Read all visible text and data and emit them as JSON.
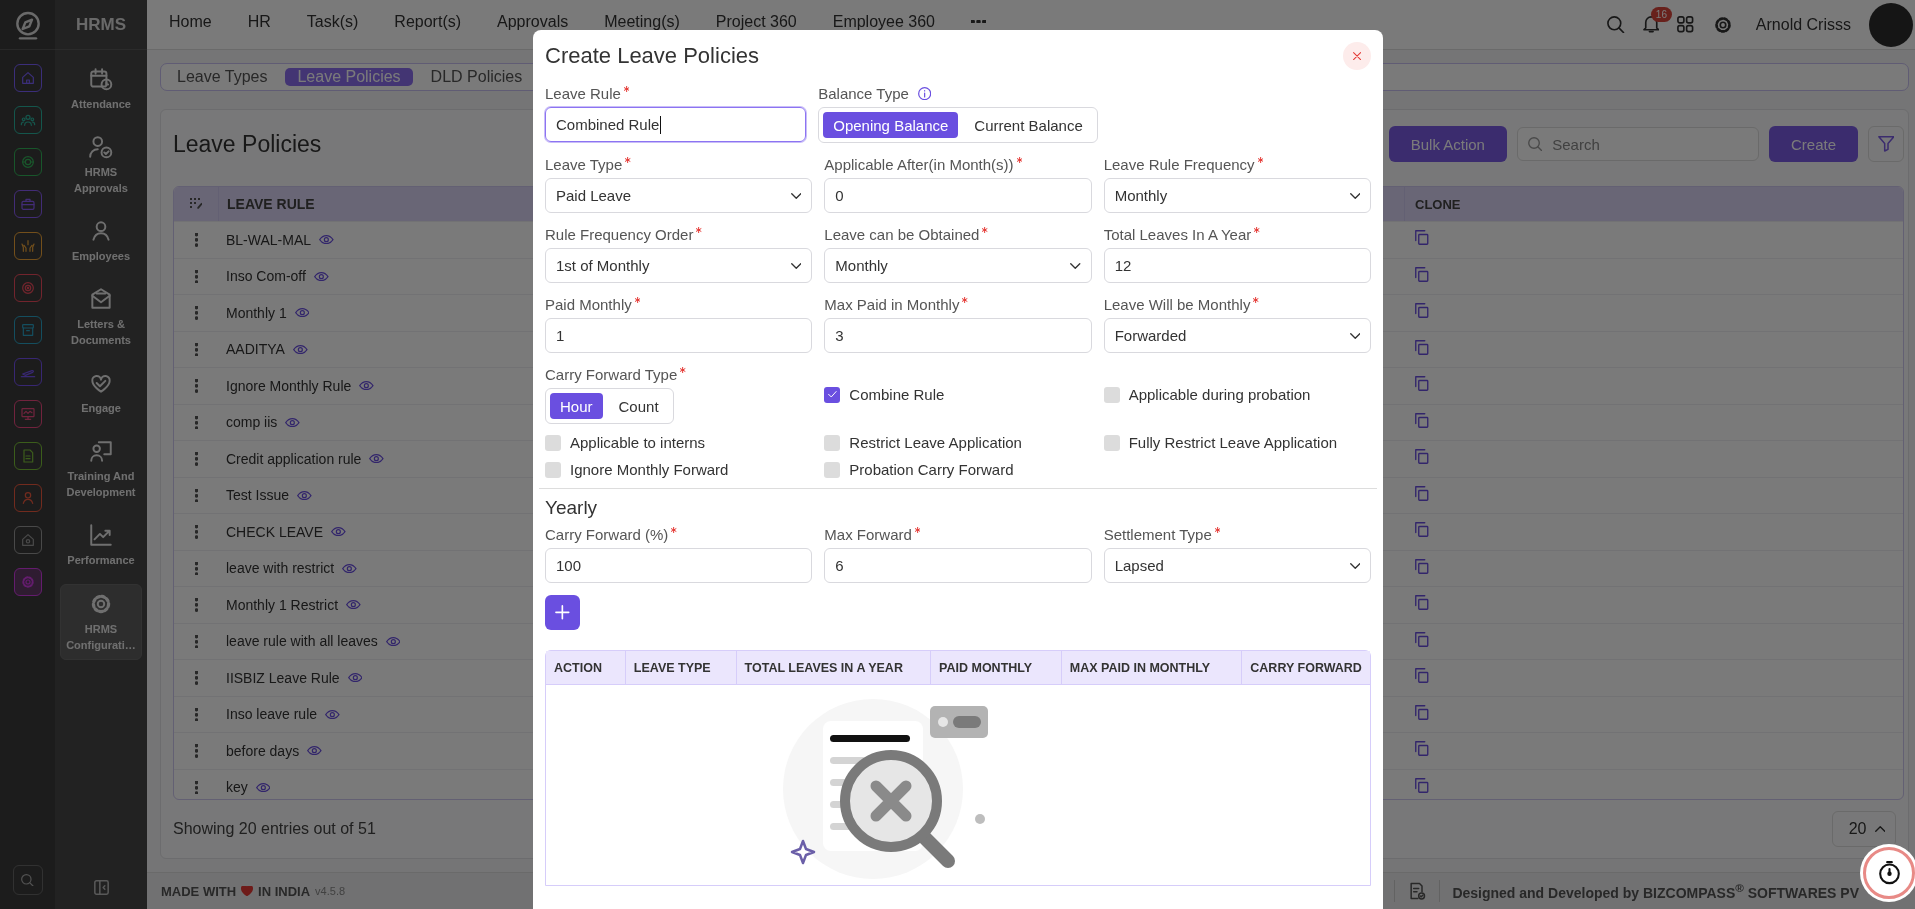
{
  "app": {
    "name": "HRMS"
  },
  "rail": {
    "items": [
      {
        "selected": false
      },
      {
        "selected": false
      },
      {
        "selected": false
      },
      {
        "selected": false
      },
      {
        "selected": false
      },
      {
        "selected": false
      },
      {
        "selected": false
      },
      {
        "selected": false
      },
      {
        "selected": false
      },
      {
        "selected": false
      },
      {
        "selected": false
      },
      {
        "selected": false
      },
      {
        "selected": true
      }
    ]
  },
  "sidebar": {
    "items": [
      {
        "label": "Attendance",
        "selected": false
      },
      {
        "label": "HRMS Approvals",
        "selected": false
      },
      {
        "label": "Employees",
        "selected": false
      },
      {
        "label": "Letters & Documents",
        "selected": false
      },
      {
        "label": "Engage",
        "selected": false
      },
      {
        "label": "Training And Development",
        "selected": false
      },
      {
        "label": "Performance",
        "selected": false
      },
      {
        "label": "HRMS Configurati…",
        "selected": true
      }
    ]
  },
  "top_nav": {
    "items": [
      "Home",
      "HR",
      "Task(s)",
      "Report(s)",
      "Approvals",
      "Meeting(s)",
      "Project 360",
      "Employee 360"
    ]
  },
  "user": {
    "name": "Arnold Crisss",
    "notification_count": "16"
  },
  "tabs": [
    {
      "label": "Leave Types",
      "selected": false
    },
    {
      "label": "Leave Policies",
      "selected": true
    },
    {
      "label": "DLD Policies",
      "selected": false
    }
  ],
  "page": {
    "title": "Leave Policies",
    "bulk_action": "Bulk Action",
    "search": {
      "placeholder": "Search"
    },
    "create": "Create"
  },
  "table": {
    "columns": [
      "LEAVE RULE",
      "CLONE"
    ],
    "rows": [
      "BL-WAL-MAL",
      "Inso Com-off",
      "Monthly 1",
      "AADITYA",
      "Ignore Monthly Rule",
      "comp iis",
      "Credit application rule",
      "Test Issue",
      "CHECK LEAVE",
      "leave with restrict",
      "Monthly 1 Restrict",
      "leave rule with all leaves",
      "IISBIZ Leave Rule",
      "Inso leave rule",
      "before days",
      "key"
    ]
  },
  "pagination": {
    "summary": "Showing 20 entries out of 51",
    "page_size": "20"
  },
  "footer": {
    "made_with": "MADE WITH",
    "in_india": "IN INDIA",
    "version": "v4.5.8",
    "credit": "Designed and Developed by  BIZCOMPASS$^{®}$ SOFTWARES PV"
  },
  "modal": {
    "title": "Create Leave Policies",
    "rows": [
      {
        "fields": [
          {
            "kind": "text",
            "label": "Leave Rule",
            "required": true,
            "value": "Combined Rule",
            "focused": true
          },
          {
            "kind": "toggle",
            "label": "Balance Type",
            "required": false,
            "info": true,
            "options": [
              {
                "label": "Opening Balance",
                "selected": true
              },
              {
                "label": "Current Balance",
                "selected": false
              }
            ]
          }
        ]
      },
      {
        "fields": [
          {
            "kind": "select",
            "label": "Leave Type",
            "required": true,
            "value": "Paid Leave"
          },
          {
            "kind": "text",
            "label": "Applicable After(in Month(s))",
            "required": true,
            "value": "0",
            "focused": false
          },
          {
            "kind": "select",
            "label": "Leave Rule Frequency",
            "required": true,
            "value": "Monthly"
          }
        ]
      },
      {
        "fields": [
          {
            "kind": "select",
            "label": "Rule Frequency Order",
            "required": true,
            "value": "1st of Monthly"
          },
          {
            "kind": "select",
            "label": "Leave can be Obtained",
            "required": true,
            "value": "Monthly"
          },
          {
            "kind": "text",
            "label": "Total Leaves In A Year",
            "required": true,
            "value": "12",
            "focused": false
          }
        ]
      },
      {
        "fields": [
          {
            "kind": "text",
            "label": "Paid Monthly",
            "required": true,
            "value": "1",
            "focused": false
          },
          {
            "kind": "text",
            "label": "Max Paid in Monthly",
            "required": true,
            "value": "3",
            "focused": false
          },
          {
            "kind": "select",
            "label": "Leave Will be Monthly",
            "required": true,
            "value": "Forwarded"
          }
        ]
      },
      {
        "fields": [
          {
            "kind": "toggle",
            "label": "Carry Forward Type",
            "required": true,
            "info": false,
            "options": [
              {
                "label": "Hour",
                "selected": true
              },
              {
                "label": "Count",
                "selected": false
              }
            ]
          },
          {
            "kind": "checkbox",
            "label": "Combine Rule",
            "checked": true
          },
          {
            "kind": "checkbox",
            "label": "Applicable during probation",
            "checked": false
          }
        ]
      },
      {
        "fields": [
          {
            "kind": "checkbox",
            "label": "Applicable to interns",
            "checked": false
          },
          {
            "kind": "checkbox",
            "label": "Restrict Leave Application",
            "checked": false
          },
          {
            "kind": "checkbox",
            "label": "Fully Restrict Leave Application",
            "checked": false
          }
        ]
      },
      {
        "fields": [
          {
            "kind": "checkbox",
            "label": "Ignore Monthly Forward",
            "checked": false
          },
          {
            "kind": "checkbox",
            "label": "Probation Carry Forward",
            "checked": false
          }
        ]
      }
    ],
    "section": {
      "title": "Yearly",
      "fields": [
        {
          "kind": "text",
          "label": "Carry Forward (%)",
          "required": true,
          "value": "100",
          "focused": false
        },
        {
          "kind": "text",
          "label": "Max Forward",
          "required": true,
          "value": "6",
          "focused": false
        },
        {
          "kind": "select",
          "label": "Settlement Type",
          "required": true,
          "value": "Lapsed"
        }
      ]
    },
    "table": {
      "columns": [
        "ACTION",
        "LEAVE TYPE",
        "TOTAL LEAVES IN A YEAR",
        "PAID MONTHLY",
        "MAX PAID IN MONTHLY",
        "CARRY FORWARD"
      ]
    }
  }
}
